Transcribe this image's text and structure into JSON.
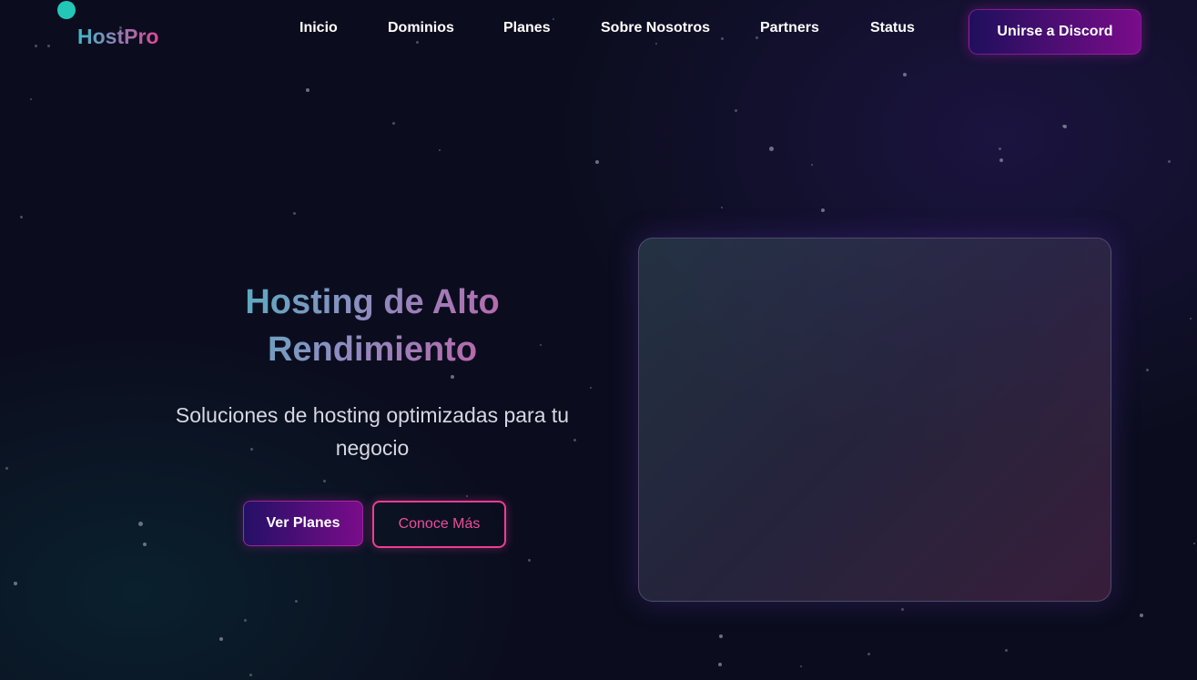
{
  "header": {
    "brand": "HostPro",
    "nav": [
      {
        "label": "Inicio"
      },
      {
        "label": "Dominios"
      },
      {
        "label": "Planes"
      },
      {
        "label": "Sobre Nosotros"
      },
      {
        "label": "Partners"
      },
      {
        "label": "Status"
      }
    ],
    "cta_label": "Unirse a Discord"
  },
  "hero": {
    "title_line1": "Hosting de Alto",
    "title_line2": "Rendimiento",
    "subtitle": "Soluciones de hosting optimizadas para tu negocio",
    "primary_button": "Ver Planes",
    "secondary_button": "Conoce Más"
  },
  "colors": {
    "background": "#0b0d1e",
    "accent_teal": "#22c7b8",
    "accent_pink": "#ec3d95",
    "accent_purple": "#7a0c8a",
    "button_dark": "#1f0f5c"
  }
}
